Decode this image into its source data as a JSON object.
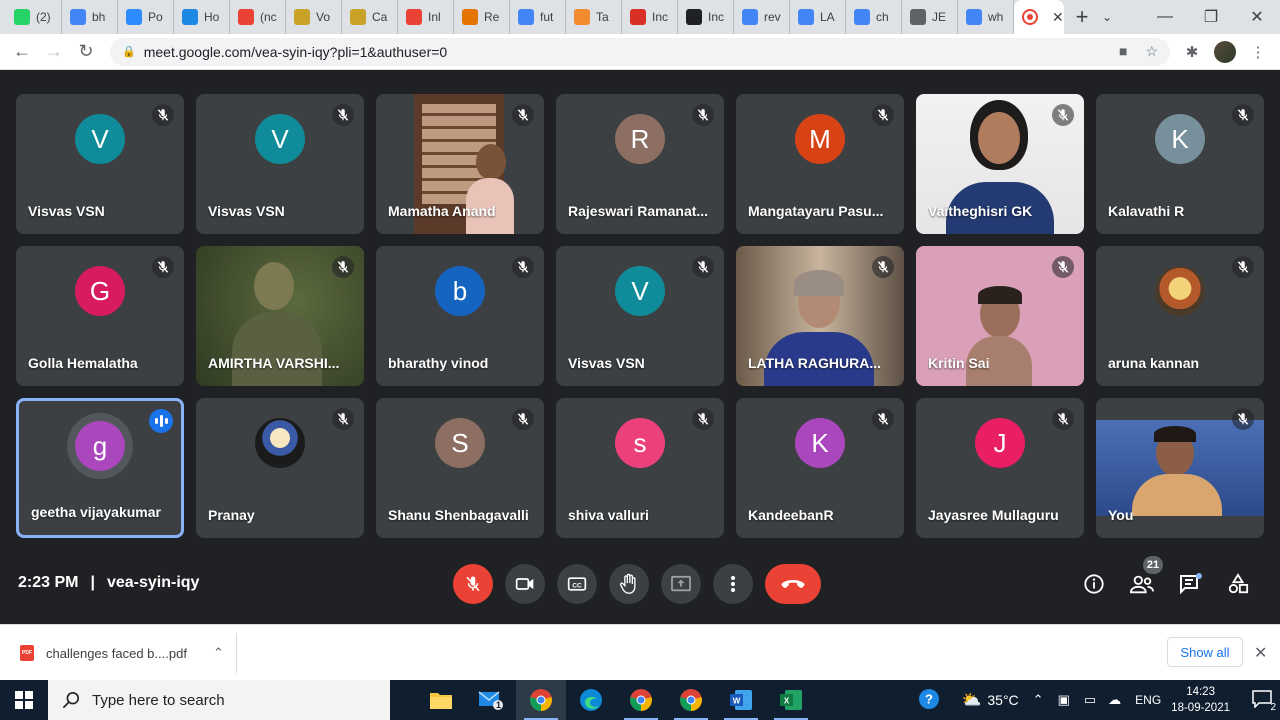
{
  "browser": {
    "tabs": [
      {
        "label": "(2)",
        "icon": "whatsapp-icon",
        "color": "#25d366"
      },
      {
        "label": "bh",
        "icon": "google-drive-icon",
        "color": "#4285f4"
      },
      {
        "label": "Po",
        "icon": "zoom-icon",
        "color": "#2d8cff"
      },
      {
        "label": "Ho",
        "icon": "f-icon",
        "color": "#1e88e5"
      },
      {
        "label": "(nc",
        "icon": "gmail-icon",
        "color": "#ea4335"
      },
      {
        "label": "Vo",
        "icon": "deity-icon",
        "color": "#c9a227"
      },
      {
        "label": "Ca",
        "icon": "deity-icon",
        "color": "#c9a227"
      },
      {
        "label": "Inl",
        "icon": "gmail-icon",
        "color": "#ea4335"
      },
      {
        "label": "Re",
        "icon": "food-icon",
        "color": "#e37400"
      },
      {
        "label": "fut",
        "icon": "google-icon",
        "color": "#4285f4"
      },
      {
        "label": "Ta",
        "icon": "ta-icon",
        "color": "#f28b30"
      },
      {
        "label": "Inc",
        "icon": "et-icon",
        "color": "#d93025"
      },
      {
        "label": "Inc",
        "icon": "newspaper-icon",
        "color": "#202124"
      },
      {
        "label": "rev",
        "icon": "google-icon",
        "color": "#4285f4"
      },
      {
        "label": "LA",
        "icon": "google-icon",
        "color": "#4285f4"
      },
      {
        "label": "ch",
        "icon": "google-icon",
        "color": "#4285f4"
      },
      {
        "label": "JE",
        "icon": "globe-icon",
        "color": "#5f6368"
      },
      {
        "label": "wh",
        "icon": "google-icon",
        "color": "#4285f4"
      }
    ],
    "active_tab_label": "",
    "url": "meet.google.com/vea-syin-iqy?pli=1&authuser=0"
  },
  "participants": [
    {
      "name": "Visvas VSN",
      "initial": "V",
      "color": "#0f8b99",
      "muted": true
    },
    {
      "name": "Visvas VSN",
      "initial": "V",
      "color": "#0f8b99",
      "muted": true
    },
    {
      "name": "Mamatha Anand",
      "video": "door",
      "muted": true
    },
    {
      "name": "Rajeswari Ramanat...",
      "initial": "R",
      "color": "#8d6e63",
      "muted": true
    },
    {
      "name": "Mangatayaru Pasu...",
      "initial": "M",
      "color": "#d84315",
      "muted": true
    },
    {
      "name": "Vaitheghisri GK",
      "video": "girl",
      "muted": true
    },
    {
      "name": "Kalavathi R",
      "initial": "K",
      "color": "#78909c",
      "muted": true
    },
    {
      "name": "Golla Hemalatha",
      "initial": "G",
      "color": "#d81b60",
      "muted": true
    },
    {
      "name": "AMIRTHA VARSHI...",
      "video": "dark",
      "muted": true
    },
    {
      "name": "bharathy vinod",
      "initial": "b",
      "color": "#1565c0",
      "muted": true
    },
    {
      "name": "Visvas VSN",
      "initial": "V",
      "color": "#0f8b99",
      "muted": true
    },
    {
      "name": "LATHA RAGHURA...",
      "video": "woman",
      "muted": true
    },
    {
      "name": "Kritin Sai",
      "video": "boy",
      "muted": true
    },
    {
      "name": "aruna kannan",
      "picture": "deity",
      "muted": true
    },
    {
      "name": "geetha vijayakumar",
      "initial": "g",
      "color": "#ab47bc",
      "muted": false,
      "speaking": true
    },
    {
      "name": "Pranay",
      "picture": "krishna",
      "muted": true
    },
    {
      "name": "Shanu Shenbagavalli",
      "initial": "S",
      "color": "#8d6e63",
      "muted": true
    },
    {
      "name": "shiva valluri",
      "initial": "s",
      "color": "#ec407a",
      "muted": true
    },
    {
      "name": "KandeebanR",
      "initial": "K",
      "color": "#ab47bc",
      "muted": true
    },
    {
      "name": "Jayasree Mullaguru",
      "initial": "J",
      "color": "#e91e63",
      "muted": true
    },
    {
      "name": "You",
      "video": "self",
      "muted": true
    }
  ],
  "meeting": {
    "time": "2:23 PM",
    "separator": "|",
    "code": "vea-syin-iqy",
    "participant_count": "21"
  },
  "controls": {
    "mic": "mic-off-icon",
    "camera": "camera-icon",
    "captions": "captions-icon",
    "hand": "raise-hand-icon",
    "present": "present-icon",
    "more": "more-icon",
    "end_call": "end-call-icon",
    "end_call_color": "#ea4335"
  },
  "downloads": {
    "file_name": "challenges faced b....pdf",
    "file_type": "PDF",
    "show_all": "Show all"
  },
  "taskbar": {
    "search_placeholder": "Type here to search",
    "mail_badge": "1",
    "temperature": "35°C",
    "language": "ENG",
    "time": "14:23",
    "date": "18-09-2021",
    "notifications": "2"
  }
}
